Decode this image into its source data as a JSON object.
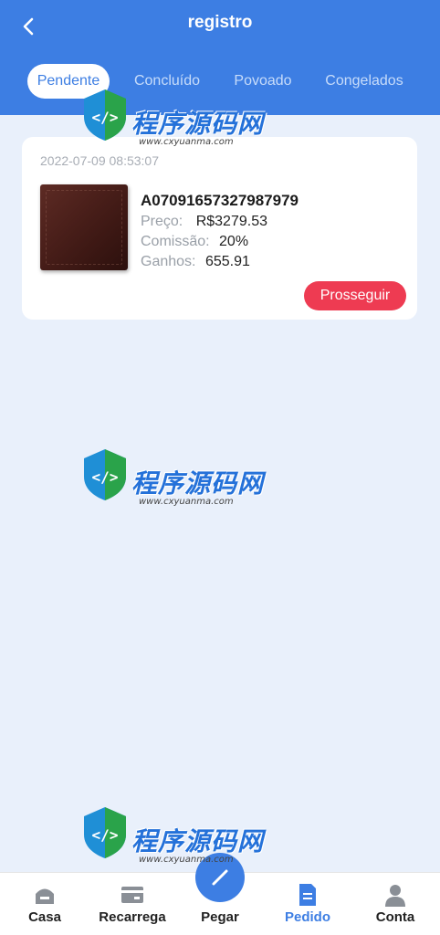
{
  "header": {
    "title": "registro",
    "back_icon": "chevron-left-icon",
    "bg_color": "#3d7ee3"
  },
  "tabs": [
    {
      "label": "Pendente",
      "active": true
    },
    {
      "label": "Concluído",
      "active": false
    },
    {
      "label": "Povoado",
      "active": false
    },
    {
      "label": "Congelados",
      "active": false
    }
  ],
  "order": {
    "date": "2022-07-09 08:53:07",
    "number": "A07091657327987979",
    "price_label": "Preço:",
    "price_value": "R$3279.53",
    "commission_label": "Comissão:",
    "commission_value": "20%",
    "earnings_label": "Ganhos:",
    "earnings_value": "655.91",
    "action_label": "Prosseguir",
    "action_color": "#ee3b52"
  },
  "watermark": {
    "text": "程序源码网",
    "url": "www.cxyuanma.com"
  },
  "bottom_nav": [
    {
      "label": "Casa",
      "icon": "home-icon",
      "active": false
    },
    {
      "label": "Recarrega",
      "icon": "card-icon",
      "active": false
    },
    {
      "label": "Pegar",
      "icon": "grab-icon",
      "active": false
    },
    {
      "label": "Pedido",
      "icon": "document-icon",
      "active": true
    },
    {
      "label": "Conta",
      "icon": "user-icon",
      "active": false
    }
  ]
}
